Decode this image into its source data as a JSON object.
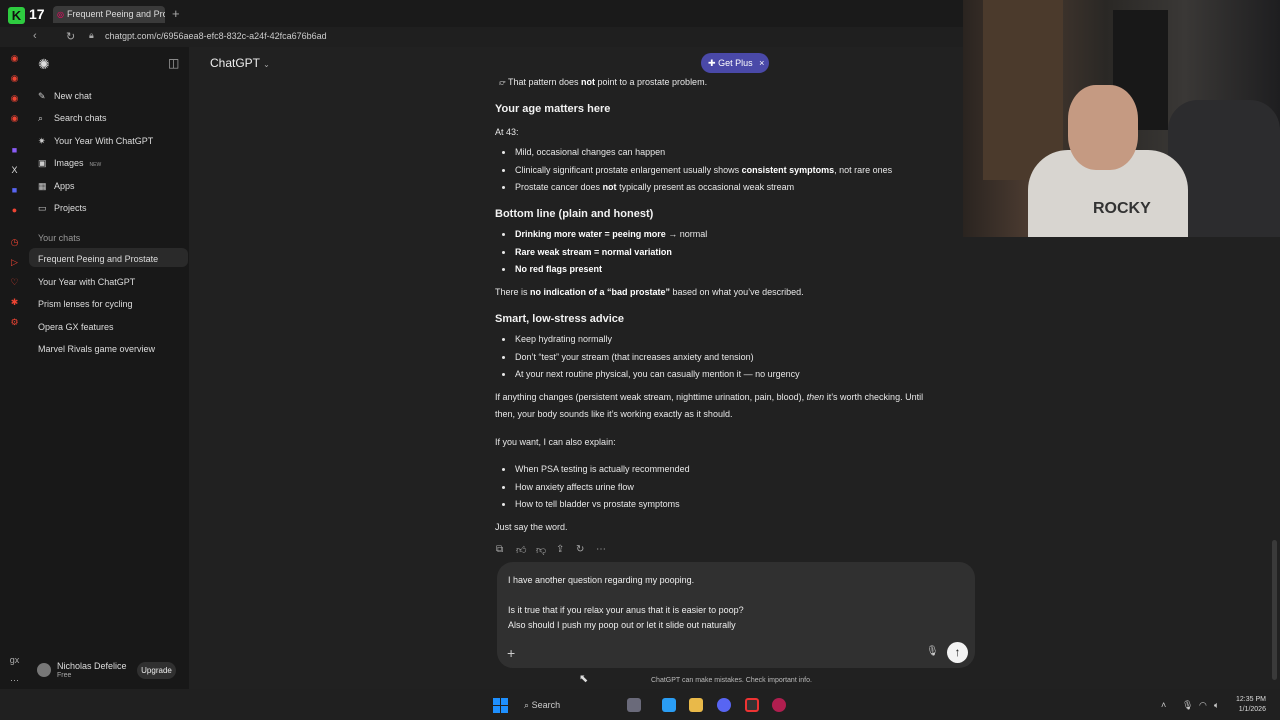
{
  "browser": {
    "tab_title": "Frequent Peeing and Prost",
    "version_badge": "17",
    "url": "chatgpt.com/c/6956aea8-efc8-832c-a24f-42fca676b6ad"
  },
  "sidebar": {
    "menu": [
      {
        "label": "New chat",
        "icon": "edit-icon"
      },
      {
        "label": "Search chats",
        "icon": "search-icon"
      },
      {
        "label": "Your Year With ChatGPT",
        "icon": "sparkle-icon"
      },
      {
        "label": "Images",
        "icon": "image-icon",
        "badge": "NEW"
      },
      {
        "label": "Apps",
        "icon": "grid-icon"
      },
      {
        "label": "Projects",
        "icon": "folder-icon"
      }
    ],
    "section_label": "Your chats",
    "chats": [
      "Frequent Peeing and Prostate",
      "Your Year with ChatGPT",
      "Prism lenses for cycling",
      "Opera GX features",
      "Marvel Rivals game overview"
    ],
    "user": {
      "name": "Nicholas Defelice",
      "plan": "Free",
      "upgrade_label": "Upgrade"
    }
  },
  "header": {
    "model": "ChatGPT",
    "get_plus": "Get Plus"
  },
  "message": {
    "top_line": {
      "pre": "That pattern does ",
      "bold": "not",
      "post": " point to a prostate problem."
    },
    "age_heading": "Your age matters here",
    "age_intro": "At 43:",
    "age_items": {
      "i1": "Mild, occasional changes can happen",
      "i2_pre": "Clinically significant prostate enlargement usually shows ",
      "i2_bold": "consistent symptoms",
      "i2_post": ", not rare ones",
      "i3_pre": "Prostate cancer does ",
      "i3_bold": "not",
      "i3_post": " typically present as occasional weak stream"
    },
    "bottom_heading": "Bottom line (plain and honest)",
    "bottom_items": {
      "b1_bold1": "Drinking more water = peeing more",
      "b1_post": " → normal",
      "b2_bold1": "Rare weak stream = normal variation",
      "b3_bold": "No red flags present"
    },
    "indication": {
      "pre": "There is ",
      "bold": "no indication of a “bad prostate”",
      "post": " based on what you’ve described."
    },
    "advice_heading": "Smart, low-stress advice",
    "advice_items": [
      "Keep hydrating normally",
      "Don’t “test” your stream (that increases anxiety and tension)",
      "At your next routine physical, you can casually mention it — no urgency"
    ],
    "changes_line1_pre": "If anything changes (persistent weak stream, nighttime urination, pain, blood), ",
    "changes_line1_em": "then",
    "changes_line1_post": " it’s worth checking. Until",
    "changes_line2": "then, your body sounds like it’s working exactly as it should.",
    "explain_intro": "If you want, I can also explain:",
    "explain_items": [
      "When PSA testing is actually recommended",
      "How anxiety affects urine flow",
      "How to tell bladder vs prostate symptoms"
    ],
    "closing": "Just say the word."
  },
  "composer": {
    "line1": "I have another question regarding my pooping.",
    "line2": "Is it true that if you relax your anus that it is easier to poop?",
    "line3": "Also should I push my poop out or let it slide out naturally"
  },
  "disclaimer": "ChatGPT can make mistakes. Check important info.",
  "webcam": {
    "shirt_text": "ROCKY"
  },
  "taskbar": {
    "search_label": "Search",
    "time": "12:35 PM",
    "date": "1/1/2026"
  },
  "colors": {
    "accent": "#4a49a8",
    "background": "#212121",
    "sidebar": "#181818"
  }
}
